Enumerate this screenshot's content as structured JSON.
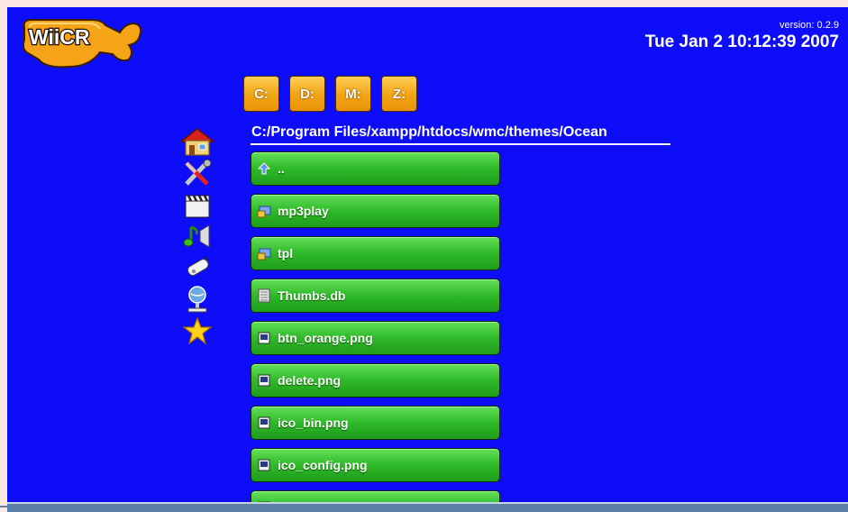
{
  "header": {
    "logo_text": "WiiCR",
    "version": "version: 0.2.9",
    "datetime": "Tue Jan 2 10:12:39 2007"
  },
  "drives": [
    {
      "label": "C:"
    },
    {
      "label": "D:"
    },
    {
      "label": "M:"
    },
    {
      "label": "Z:"
    }
  ],
  "sidebar": {
    "items": [
      {
        "icon": "home-icon"
      },
      {
        "icon": "tools-icon"
      },
      {
        "icon": "clapperboard-icon"
      },
      {
        "icon": "music-icon"
      },
      {
        "icon": "gamepad-icon"
      },
      {
        "icon": "network-icon"
      },
      {
        "icon": "star-icon"
      }
    ]
  },
  "path": "C:/Program Files/xampp/htdocs/wmc/themes/Ocean",
  "files": [
    {
      "name": "..",
      "icon": "up-arrow-icon"
    },
    {
      "name": "mp3play",
      "icon": "folder-icon"
    },
    {
      "name": "tpl",
      "icon": "folder-icon"
    },
    {
      "name": "Thumbs.db",
      "icon": "database-file-icon"
    },
    {
      "name": "btn_orange.png",
      "icon": "image-file-icon"
    },
    {
      "name": "delete.png",
      "icon": "image-file-icon"
    },
    {
      "name": "ico_bin.png",
      "icon": "image-file-icon"
    },
    {
      "name": "ico_config.png",
      "icon": "image-file-icon"
    },
    {
      "name": "",
      "icon": "image-file-icon"
    }
  ],
  "colors": {
    "background": "#0d0dfa",
    "file_button": "#2eb928",
    "drive_button": "#f2a412"
  }
}
